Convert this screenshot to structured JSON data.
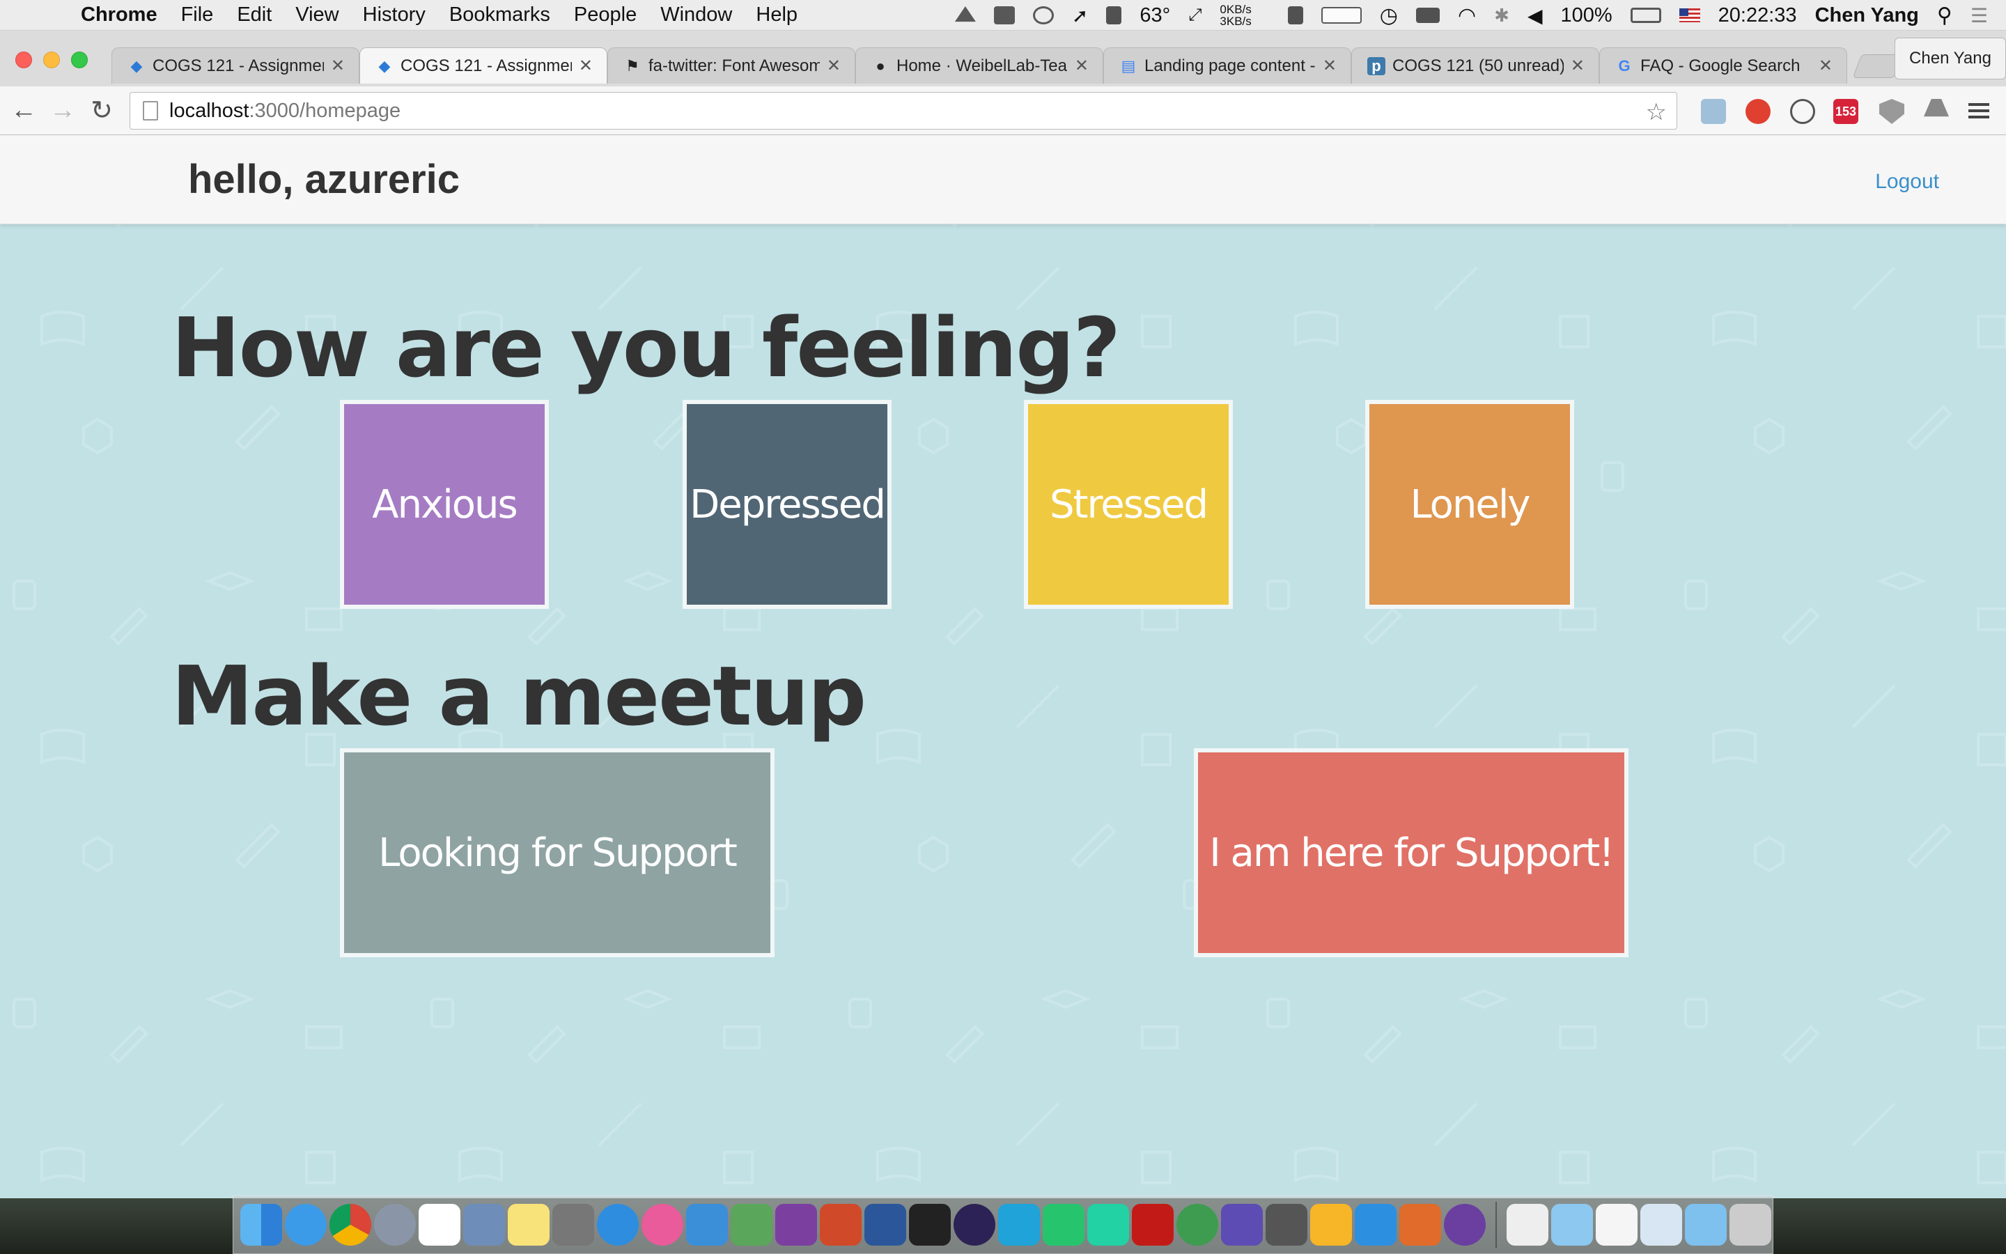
{
  "menubar": {
    "app_name": "Chrome",
    "menus": [
      "File",
      "Edit",
      "View",
      "History",
      "Bookmarks",
      "People",
      "Window",
      "Help"
    ],
    "temperature": "63°",
    "net_up": "0KB/s",
    "net_down": "3KB/s",
    "battery": "100%",
    "clock": "20:22:33",
    "user": "Chen Yang"
  },
  "browser": {
    "tabs": [
      {
        "title": "COGS 121 - Assignmen",
        "icon": "diamond-icon",
        "color": "#2b7bd6",
        "active": false
      },
      {
        "title": "COGS 121 - Assignmen",
        "icon": "diamond-icon",
        "color": "#2b7bd6",
        "active": true
      },
      {
        "title": "fa-twitter: Font Awesom",
        "icon": "flag-icon",
        "color": "#222222",
        "active": false
      },
      {
        "title": "Home · WeibelLab-Teac",
        "icon": "github-icon",
        "color": "#222222",
        "active": false
      },
      {
        "title": "Landing page content -",
        "icon": "docs-icon",
        "color": "#4285f4",
        "active": false
      },
      {
        "title": "COGS 121 (50 unread)",
        "icon": "piazza-icon",
        "color": "#3e7aab",
        "active": false
      },
      {
        "title": "FAQ - Google Search",
        "icon": "google-icon",
        "color": "#4285f4",
        "active": false
      }
    ],
    "profile": "Chen Yang",
    "url_host": "localhost",
    "url_path": ":3000/homepage",
    "extension_badge": "153"
  },
  "page": {
    "greeting": "hello, azureric",
    "logout": "Logout",
    "feeling_heading": "How are you feeling?",
    "moods": [
      {
        "label": "Anxious",
        "color": "#a57cc3"
      },
      {
        "label": "Depressed",
        "color": "#516675"
      },
      {
        "label": "Stressed",
        "color": "#efc940"
      },
      {
        "label": "Lonely",
        "color": "#df964f"
      }
    ],
    "meetup_heading": "Make a meetup",
    "meetups": [
      {
        "label": "Looking for Support",
        "color": "#8fa3a3"
      },
      {
        "label": "I am here for Support!",
        "color": "#e07167"
      }
    ],
    "background_color": "#c2e1e5"
  }
}
